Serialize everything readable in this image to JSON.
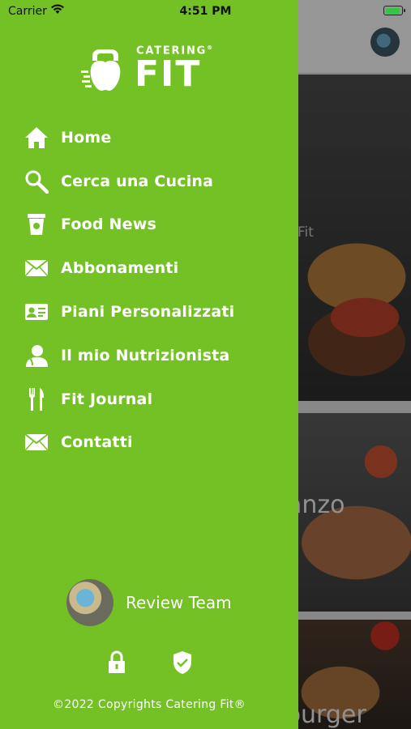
{
  "status_bar": {
    "carrier": "Carrier",
    "time": "4:51 PM"
  },
  "background": {
    "cards": [
      {
        "title": "ng Fit"
      },
      {
        "title": "anzo"
      },
      {
        "title": "burger"
      }
    ]
  },
  "drawer": {
    "logo": {
      "small": "CATERING",
      "big": "FIT",
      "mark": "®"
    },
    "menu": [
      {
        "label": "Home",
        "icon": "home-icon"
      },
      {
        "label": "Cerca una Cucina",
        "icon": "search-icon"
      },
      {
        "label": "Food News",
        "icon": "coffee-cup-icon"
      },
      {
        "label": "Abbonamenti",
        "icon": "envelope-icon"
      },
      {
        "label": "Piani Personalizzati",
        "icon": "id-card-icon"
      },
      {
        "label": "Il mio Nutrizionista",
        "icon": "doctor-icon"
      },
      {
        "label": "Fit Journal",
        "icon": "fork-knife-icon"
      },
      {
        "label": "Contatti",
        "icon": "envelope-icon"
      }
    ],
    "profile": {
      "name": "Review Team"
    },
    "copyright": "©2022 Copyrights Catering Fit®"
  },
  "colors": {
    "drawer_bg": "#74c126",
    "text": "#ffffff"
  }
}
